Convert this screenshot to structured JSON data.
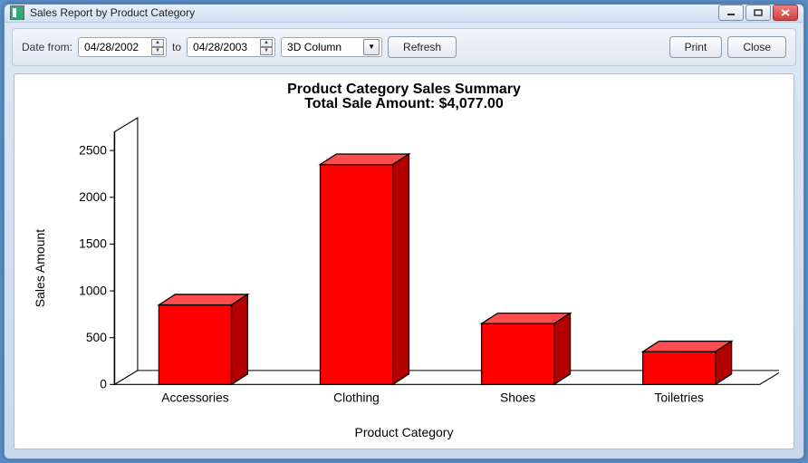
{
  "window": {
    "title": "Sales Report by Product Category"
  },
  "toolbar": {
    "date_from_label": "Date from:",
    "date_from_value": "04/28/2002",
    "to_label": "to",
    "date_to_value": "04/28/2003",
    "chart_type_selected": "3D Column",
    "refresh_label": "Refresh",
    "print_label": "Print",
    "close_label": "Close"
  },
  "chart": {
    "title": "Product Category Sales Summary",
    "subtitle": "Total Sale Amount:  $4,077.00",
    "ylabel": "Sales Amount",
    "xlabel": "Product Category"
  },
  "chart_data": {
    "type": "bar",
    "style": "3d-column",
    "categories": [
      "Accessories",
      "Clothing",
      "Shoes",
      "Toiletries"
    ],
    "values": [
      850,
      2350,
      650,
      350
    ],
    "title": "Product Category Sales Summary",
    "subtitle": "Total Sale Amount:  $4,077.00",
    "xlabel": "Product Category",
    "ylabel": "Sales Amount",
    "ylim": [
      0,
      2700
    ],
    "yticks": [
      0,
      500,
      1000,
      1500,
      2000,
      2500
    ],
    "bar_color": "#ff0000"
  }
}
